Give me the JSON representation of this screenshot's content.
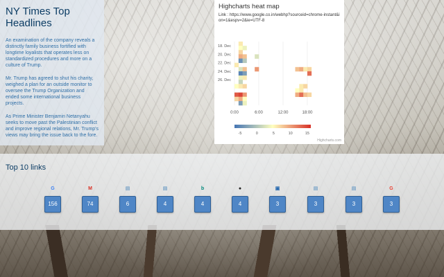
{
  "news": {
    "title": "NY Times Top Headlines",
    "items": [
      "An examination of the company reveals a distinctly family business fortified with longtime loyalists that operates less on standardized procedures and more on a culture of Trump.",
      "Mr. Trump has agreed to shut his charity, weighed a plan for an outside monitor to oversee the Trump Organization and ended some international business projects.",
      "As Prime Minister Benjamin Netanyahu seeks to move past the Palestinian conflict and improve regional relations, Mr. Trump's views may bring the issue back to the fore."
    ]
  },
  "chart": {
    "title": "Highcharts heat map",
    "link": "Link : https://www.google.co.in/webhp?sourceid=chrome-instant&ion=1&espv=2&ie=UTF-8",
    "credit": "Highcharts.com"
  },
  "chart_data": {
    "type": "heatmap",
    "title": "Highcharts heat map",
    "y_categories": [
      "18. Dec",
      "20. Dec",
      "22. Dec",
      "24. Dec",
      "26. Dec"
    ],
    "x_ticks": [
      "0:00",
      "6:00",
      "12:00",
      "18:00"
    ],
    "color_axis": {
      "min": -5,
      "max": 15,
      "ticks": [
        "-5",
        "0",
        "5",
        "10",
        "15"
      ],
      "colors": [
        "#4575b4",
        "#ffffbf",
        "#d73027"
      ]
    },
    "cells": [
      {
        "day": 0,
        "hour": 1,
        "v": 6
      },
      {
        "day": 1,
        "hour": 1,
        "v": 5
      },
      {
        "day": 1,
        "hour": 2,
        "v": 4
      },
      {
        "day": 2,
        "hour": 1,
        "v": 7
      },
      {
        "day": 3,
        "hour": 1,
        "v": 9
      },
      {
        "day": 3,
        "hour": 2,
        "v": 8
      },
      {
        "day": 3,
        "hour": 5,
        "v": 3
      },
      {
        "day": 4,
        "hour": 1,
        "v": -3
      },
      {
        "day": 4,
        "hour": 2,
        "v": 1
      },
      {
        "day": 5,
        "hour": 0,
        "v": 6
      },
      {
        "day": 6,
        "hour": 1,
        "v": 3
      },
      {
        "day": 6,
        "hour": 2,
        "v": 8
      },
      {
        "day": 6,
        "hour": 5,
        "v": 10
      },
      {
        "day": 6,
        "hour": 15,
        "v": 8
      },
      {
        "day": 6,
        "hour": 16,
        "v": 9
      },
      {
        "day": 6,
        "hour": 17,
        "v": 6
      },
      {
        "day": 6,
        "hour": 18,
        "v": 7
      },
      {
        "day": 7,
        "hour": 1,
        "v": -4
      },
      {
        "day": 7,
        "hour": 2,
        "v": -2
      },
      {
        "day": 7,
        "hour": 18,
        "v": 12
      },
      {
        "day": 8,
        "hour": 1,
        "v": 4
      },
      {
        "day": 8,
        "hour": 2,
        "v": 6
      },
      {
        "day": 9,
        "hour": 1,
        "v": 2
      },
      {
        "day": 10,
        "hour": 0,
        "v": 5
      },
      {
        "day": 10,
        "hour": 1,
        "v": 6
      },
      {
        "day": 10,
        "hour": 2,
        "v": 7
      },
      {
        "day": 10,
        "hour": 16,
        "v": 6
      },
      {
        "day": 10,
        "hour": 17,
        "v": 7
      },
      {
        "day": 11,
        "hour": 15,
        "v": 5
      },
      {
        "day": 11,
        "hour": 16,
        "v": 6
      },
      {
        "day": 12,
        "hour": 0,
        "v": 13
      },
      {
        "day": 12,
        "hour": 1,
        "v": 14
      },
      {
        "day": 12,
        "hour": 2,
        "v": 10
      },
      {
        "day": 12,
        "hour": 15,
        "v": 9
      },
      {
        "day": 12,
        "hour": 16,
        "v": 12
      },
      {
        "day": 12,
        "hour": 17,
        "v": 8
      },
      {
        "day": 12,
        "hour": 18,
        "v": 7
      },
      {
        "day": 13,
        "hour": 0,
        "v": 7
      },
      {
        "day": 13,
        "hour": 1,
        "v": 9
      },
      {
        "day": 13,
        "hour": 2,
        "v": 5
      },
      {
        "day": 14,
        "hour": 1,
        "v": -2
      },
      {
        "day": 14,
        "hour": 2,
        "v": 4
      }
    ]
  },
  "links": {
    "title": "Top 10 links",
    "items": [
      {
        "icon": "google-icon",
        "glyph": "G",
        "color": "#4285f4",
        "count": "156"
      },
      {
        "icon": "gmail-icon",
        "glyph": "M",
        "color": "#d93025",
        "count": "74"
      },
      {
        "icon": "page-icon",
        "glyph": "▤",
        "color": "#7fa7c9",
        "count": "6"
      },
      {
        "icon": "page-icon",
        "glyph": "▤",
        "color": "#7fa7c9",
        "count": "4"
      },
      {
        "icon": "bing-icon",
        "glyph": "b",
        "color": "#00897b",
        "count": "4"
      },
      {
        "icon": "github-icon",
        "glyph": "●",
        "color": "#222222",
        "count": "4"
      },
      {
        "icon": "page-icon",
        "glyph": "▣",
        "color": "#2b6cb0",
        "count": "3"
      },
      {
        "icon": "page-icon",
        "glyph": "▤",
        "color": "#7fa7c9",
        "count": "3"
      },
      {
        "icon": "page-icon",
        "glyph": "▤",
        "color": "#7fa7c9",
        "count": "3"
      },
      {
        "icon": "google-icon",
        "glyph": "G",
        "color": "#ea4335",
        "count": "3"
      }
    ]
  }
}
